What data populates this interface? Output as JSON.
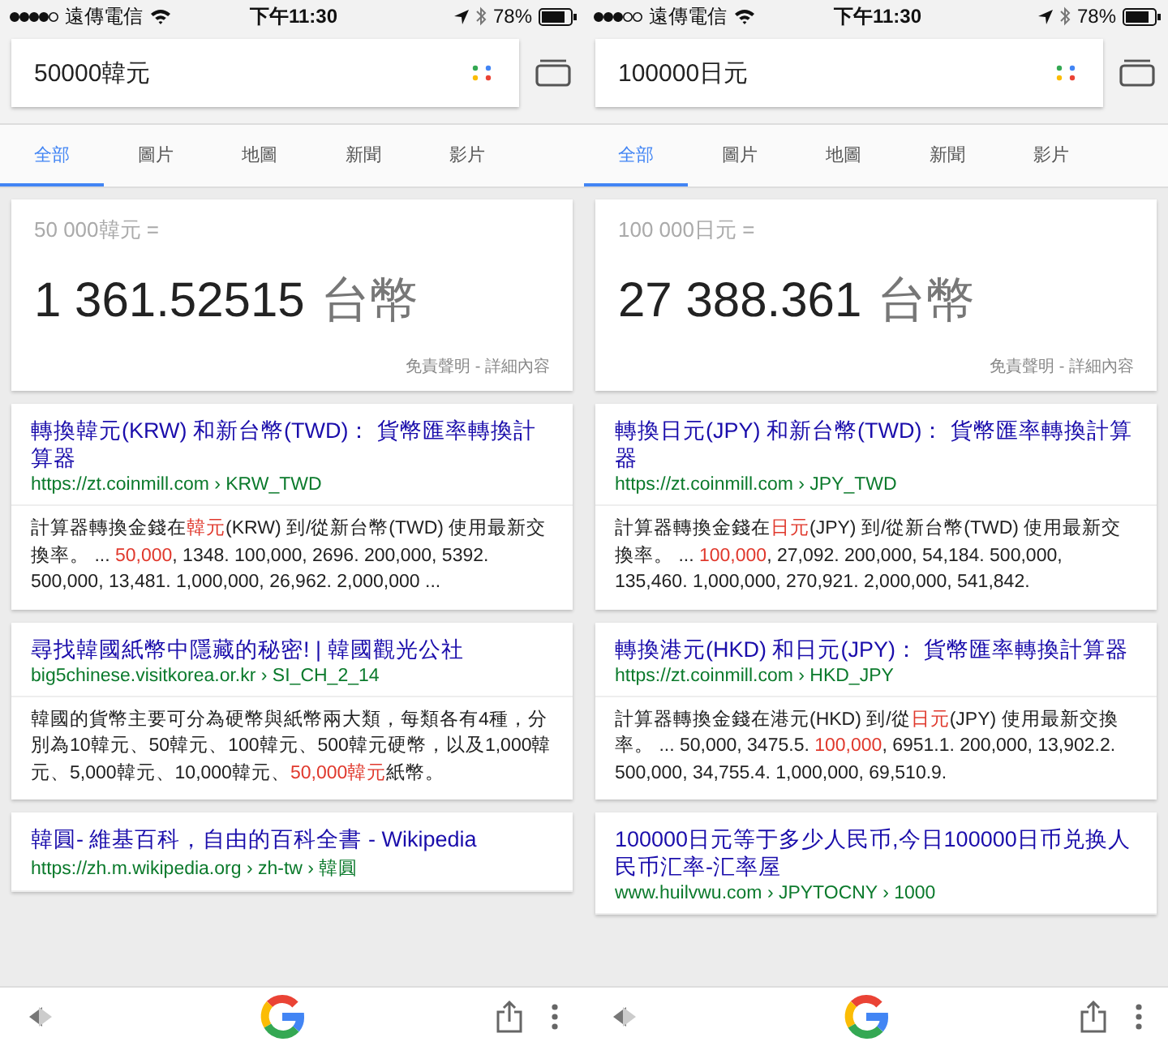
{
  "panels": [
    {
      "status": {
        "carrier": "遠傳電信",
        "time": "下午11:30",
        "battery": "78%"
      },
      "search": {
        "value": "50000韓元"
      },
      "tabs": [
        {
          "label": "全部",
          "selected": true
        },
        {
          "label": "圖片",
          "selected": false
        },
        {
          "label": "地圖",
          "selected": false
        },
        {
          "label": "新聞",
          "selected": false
        },
        {
          "label": "影片",
          "selected": false
        }
      ],
      "answer": {
        "query": "50 000韓元 =",
        "amount": "1 361.52515",
        "unit": "台幣",
        "disclaimer": "免責聲明 - 詳細內容"
      },
      "results": [
        {
          "title": "轉換韓元(KRW) 和新台幣(TWD)： 貨幣匯率轉換計算器",
          "url": "https://zt.coinmill.com › KRW_TWD",
          "snippet": [
            {
              "text": "計算器轉換金錢在",
              "highlight": false
            },
            {
              "text": "韓元",
              "highlight": true
            },
            {
              "text": "(KRW) 到/從新台幣(TWD) 使用最新交換率。 ... ",
              "highlight": false
            },
            {
              "text": "50,000",
              "highlight": true
            },
            {
              "text": ", 1348. 100,000, 2696. 200,000, 5392. 500,000, 13,481. 1,000,000, 26,962. 2,000,000  ...",
              "highlight": false
            }
          ]
        },
        {
          "title": "尋找韓國紙幣中隱藏的秘密! | 韓國觀光公社",
          "url": "big5chinese.visitkorea.or.kr › SI_CH_2_14",
          "snippet": [
            {
              "text": "韓國的貨幣主要可分為硬幣與紙幣兩大類，每類各有4種，分別為10韓元、50韓元、100韓元、500韓元硬幣，以及1,000韓元、5,000韓元、10,000韓元、",
              "highlight": false
            },
            {
              "text": "50,000韓元",
              "highlight": true
            },
            {
              "text": "紙幣。",
              "highlight": false
            }
          ]
        },
        {
          "title": "韓圓- 維基百科，自由的百科全書 - Wikipedia",
          "url": "https://zh.m.wikipedia.org › zh-tw › 韓圓"
        }
      ]
    },
    {
      "status": {
        "carrier": "遠傳電信",
        "time": "下午11:30",
        "battery": "78%"
      },
      "search": {
        "value": "100000日元"
      },
      "tabs": [
        {
          "label": "全部",
          "selected": true
        },
        {
          "label": "圖片",
          "selected": false
        },
        {
          "label": "地圖",
          "selected": false
        },
        {
          "label": "新聞",
          "selected": false
        },
        {
          "label": "影片",
          "selected": false
        }
      ],
      "answer": {
        "query": "100 000日元 =",
        "amount": "27 388.361",
        "unit": "台幣",
        "disclaimer": "免責聲明 - 詳細內容"
      },
      "results": [
        {
          "title": "轉換日元(JPY) 和新台幣(TWD)： 貨幣匯率轉換計算器",
          "url": "https://zt.coinmill.com › JPY_TWD",
          "snippet": [
            {
              "text": "計算器轉換金錢在",
              "highlight": false
            },
            {
              "text": "日元",
              "highlight": true
            },
            {
              "text": "(JPY) 到/從新台幣(TWD) 使用最新交換率。 ... ",
              "highlight": false
            },
            {
              "text": "100,000",
              "highlight": true
            },
            {
              "text": ", 27,092. 200,000, 54,184. 500,000, 135,460. 1,000,000, 270,921. 2,000,000, 541,842.",
              "highlight": false
            }
          ]
        },
        {
          "title": "轉換港元(HKD) 和日元(JPY)： 貨幣匯率轉換計算器",
          "url": "https://zt.coinmill.com › HKD_JPY",
          "snippet": [
            {
              "text": "計算器轉換金錢在港元(HKD) 到/從",
              "highlight": false
            },
            {
              "text": "日元",
              "highlight": true
            },
            {
              "text": "(JPY) 使用最新交換率。 ... 50,000, 3475.5. ",
              "highlight": false
            },
            {
              "text": "100,000",
              "highlight": true
            },
            {
              "text": ", 6951.1. 200,000, 13,902.2. 500,000, 34,755.4. 1,000,000, 69,510.9.",
              "highlight": false
            }
          ]
        },
        {
          "title": "100000日元等于多少人民币,今日100000日币兑换人民币汇率-汇率屋",
          "url": "www.huilvwu.com › JPYTOCNY › 1000"
        }
      ]
    }
  ]
}
